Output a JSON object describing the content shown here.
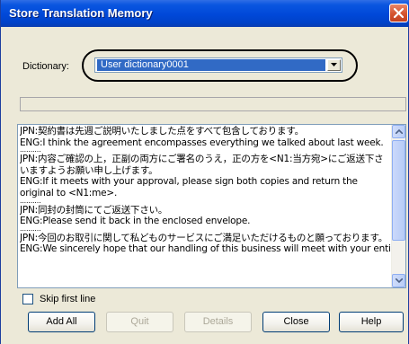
{
  "window": {
    "title": "Store Translation Memory",
    "close_icon": "close-icon"
  },
  "dictionary": {
    "label": "Dictionary:",
    "selected": "User dictionary0001",
    "dropdown_icon": "chevron-down-icon"
  },
  "progress": {
    "value": 0
  },
  "memory_text": {
    "lines": [
      "JPN:契約書は先週ご説明いたしました点をすべて包含しております。",
      "ENG:I think the agreement encompasses everything we talked about last week.",
      "..........",
      "JPN:内容ご確認の上，正副の両方にご署名のうえ，正の方を<N1:当方宛>にご返送下さいますようお願い申し上げます。",
      "ENG:If it meets with your approval, please sign both copies and return the original to <N1:me>.",
      "..........",
      "JPN:同封の封筒にてご返送下さい。",
      "ENG:Please send it back in the enclosed envelope.",
      "..........",
      "JPN:今回のお取引に関して私どものサービスにご満足いただけるものと願っております。",
      "ENG:We sincerely hope that our handling of this business will meet with your entire"
    ]
  },
  "skip_first_line": {
    "label": "Skip first line",
    "checked": false
  },
  "buttons": {
    "add_all": "Add All",
    "quit": "Quit",
    "details": "Details",
    "close": "Close",
    "help": "Help"
  },
  "colors": {
    "titlebar": "#0048d8",
    "selection": "#316ac5",
    "dialog_bg": "#ece9d8"
  }
}
